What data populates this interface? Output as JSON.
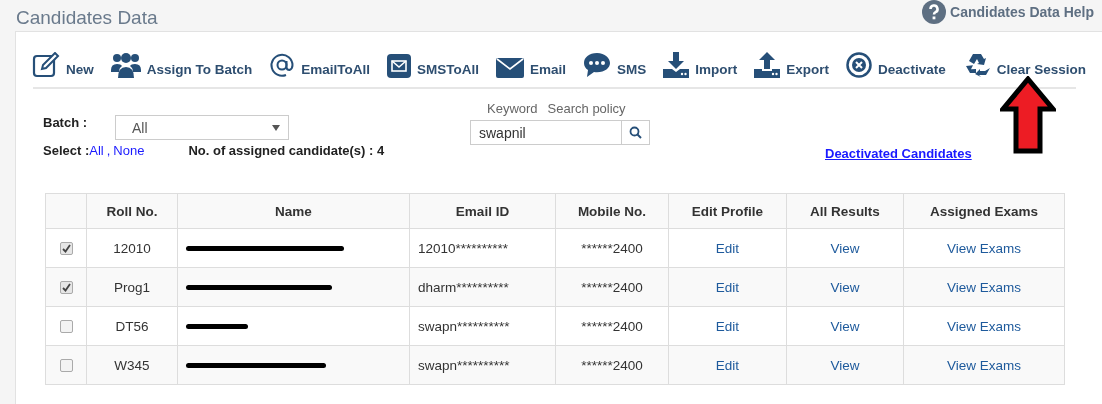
{
  "page": {
    "title": "Candidates Data",
    "help_link": "Candidates Data Help"
  },
  "toolbar": [
    {
      "kind": "new",
      "label": "New"
    },
    {
      "kind": "batch",
      "label": "Assign To Batch"
    },
    {
      "kind": "at",
      "label": "EmailToAll"
    },
    {
      "kind": "smsall",
      "label": "SMSToAll"
    },
    {
      "kind": "email",
      "label": "Email"
    },
    {
      "kind": "sms",
      "label": "SMS"
    },
    {
      "kind": "import",
      "label": "Import"
    },
    {
      "kind": "export",
      "label": "Export"
    },
    {
      "kind": "deactivate",
      "label": "Deactivate"
    },
    {
      "kind": "recycle",
      "label": "Clear Session"
    }
  ],
  "filters": {
    "batch_label": "Batch :",
    "batch_value": "All",
    "keyword_label": "Keyword",
    "search_policy_label": "Search policy",
    "search_value": "swapnil",
    "select_label": "Select :",
    "select_all": "All",
    "separator": ",",
    "select_none": "None",
    "assigned_count": "No. of assigned candidate(s) : 4",
    "deactivated_link": "Deactivated Candidates"
  },
  "annotation": {
    "kind": "arrow_up"
  },
  "table": {
    "columns": [
      "Roll No.",
      "Name",
      "Email ID",
      "Mobile No.",
      "Edit Profile",
      "All Results",
      "Assigned Exams"
    ],
    "rows": [
      {
        "checked": true,
        "roll": "12010",
        "name_redacted": true,
        "email": "12010**********",
        "mobile": "******2400",
        "edit": "Edit",
        "results": "View",
        "exams": "View Exams"
      },
      {
        "checked": true,
        "roll": "Prog1",
        "name_redacted": true,
        "email": "dharm**********",
        "mobile": "******2400",
        "edit": "Edit",
        "results": "View",
        "exams": "View Exams"
      },
      {
        "checked": false,
        "roll": "DT56",
        "name_redacted": true,
        "email": "swapn**********",
        "mobile": "******2400",
        "edit": "Edit",
        "results": "View",
        "exams": "View Exams"
      },
      {
        "checked": false,
        "roll": "W345",
        "name_redacted": true,
        "email": "swapn**********",
        "mobile": "******2400",
        "edit": "Edit",
        "results": "View",
        "exams": "View Exams"
      }
    ]
  }
}
